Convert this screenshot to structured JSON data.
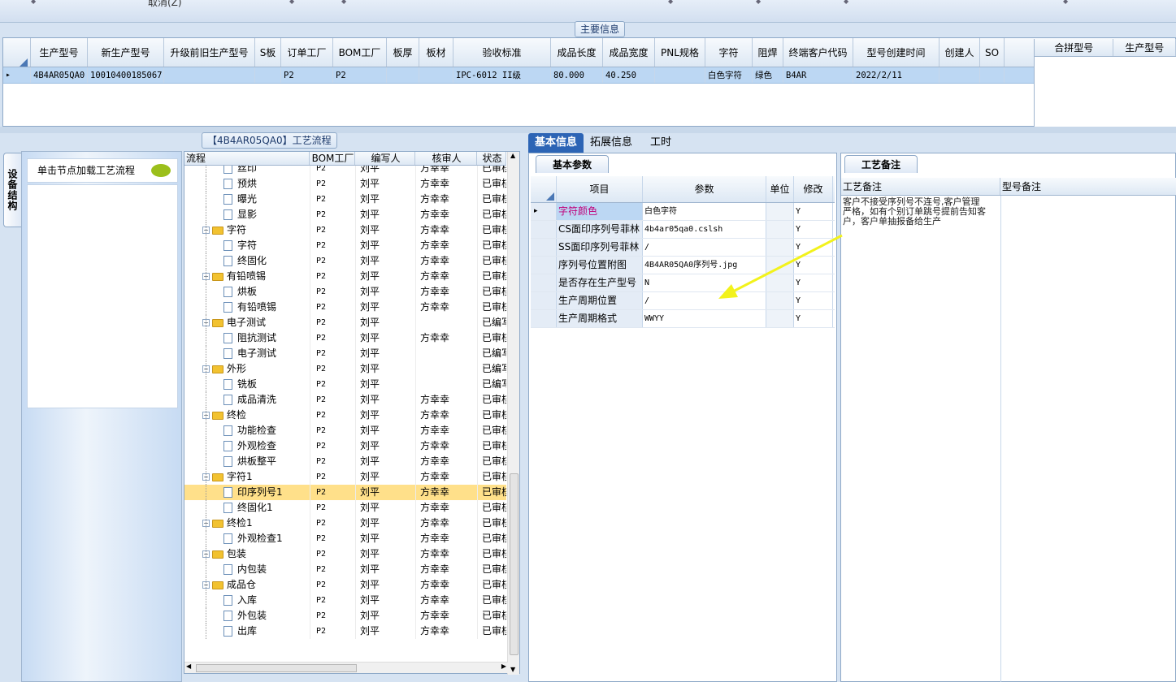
{
  "toolbar": {
    "cancel_label": "取消(Z)"
  },
  "main_info": {
    "legend": "主要信息",
    "columns": [
      "生产型号",
      "新生产型号",
      "升级前旧生产型号",
      "S板",
      "订单工厂",
      "BOM工厂",
      "板厚",
      "板材",
      "验收标准",
      "成品长度",
      "成品宽度",
      "PNL规格",
      "字符",
      "阻焊",
      "终端客户代码",
      "型号创建时间",
      "创建人",
      "SO"
    ],
    "row": {
      "生产型号": "4B4AR05QA0",
      "新生产型号": "10010400185067",
      "订单工厂": "P2",
      "BOM工厂": "P2",
      "验收标准": "IPC-6012 II级",
      "成品长度": "80.000",
      "成品宽度": "40.250",
      "字符": "白色字符",
      "阻焊": "绿色",
      "终端客户代码": "B4AR",
      "型号创建时间": "2022/2/11"
    }
  },
  "merge_panel": {
    "columns": [
      "合拼型号",
      "生产型号"
    ]
  },
  "left_panel": {
    "side_tab": "设备结构",
    "hint": "单击节点加载工艺流程"
  },
  "process_tree": {
    "title": "【4B4AR05QA0】工艺流程",
    "columns": [
      "流程",
      "BOM工厂",
      "编写人",
      "核审人",
      "状态"
    ],
    "rows": [
      {
        "name": "丝印",
        "kind": "doc",
        "bom": "P2",
        "editor": "刘平",
        "reviewer": "方幸幸",
        "status": "已审核"
      },
      {
        "name": "预烘",
        "kind": "doc",
        "bom": "P2",
        "editor": "刘平",
        "reviewer": "方幸幸",
        "status": "已审核"
      },
      {
        "name": "曝光",
        "kind": "doc",
        "bom": "P2",
        "editor": "刘平",
        "reviewer": "方幸幸",
        "status": "已审核"
      },
      {
        "name": "显影",
        "kind": "doc",
        "bom": "P2",
        "editor": "刘平",
        "reviewer": "方幸幸",
        "status": "已审核"
      },
      {
        "name": "字符",
        "kind": "folder",
        "bom": "P2",
        "editor": "刘平",
        "reviewer": "方幸幸",
        "status": "已审核"
      },
      {
        "name": "字符",
        "kind": "doc",
        "bom": "P2",
        "editor": "刘平",
        "reviewer": "方幸幸",
        "status": "已审核"
      },
      {
        "name": "终固化",
        "kind": "doc",
        "bom": "P2",
        "editor": "刘平",
        "reviewer": "方幸幸",
        "status": "已审核"
      },
      {
        "name": "有铅喷锡",
        "kind": "folder",
        "bom": "P2",
        "editor": "刘平",
        "reviewer": "方幸幸",
        "status": "已审核"
      },
      {
        "name": "烘板",
        "kind": "doc",
        "bom": "P2",
        "editor": "刘平",
        "reviewer": "方幸幸",
        "status": "已审核"
      },
      {
        "name": "有铅喷锡",
        "kind": "doc",
        "bom": "P2",
        "editor": "刘平",
        "reviewer": "方幸幸",
        "status": "已审核"
      },
      {
        "name": "电子测试",
        "kind": "folder",
        "bom": "P2",
        "editor": "刘平",
        "reviewer": "",
        "status": "已编写"
      },
      {
        "name": "阻抗测试",
        "kind": "doc",
        "bom": "P2",
        "editor": "刘平",
        "reviewer": "方幸幸",
        "status": "已审核"
      },
      {
        "name": "电子测试",
        "kind": "doc",
        "bom": "P2",
        "editor": "刘平",
        "reviewer": "",
        "status": "已编写"
      },
      {
        "name": "外形",
        "kind": "folder",
        "bom": "P2",
        "editor": "刘平",
        "reviewer": "",
        "status": "已编写"
      },
      {
        "name": "铣板",
        "kind": "doc",
        "bom": "P2",
        "editor": "刘平",
        "reviewer": "",
        "status": "已编写"
      },
      {
        "name": "成品清洗",
        "kind": "doc",
        "bom": "P2",
        "editor": "刘平",
        "reviewer": "方幸幸",
        "status": "已审核"
      },
      {
        "name": "终检",
        "kind": "folder",
        "bom": "P2",
        "editor": "刘平",
        "reviewer": "方幸幸",
        "status": "已审核"
      },
      {
        "name": "功能检查",
        "kind": "doc",
        "bom": "P2",
        "editor": "刘平",
        "reviewer": "方幸幸",
        "status": "已审核"
      },
      {
        "name": "外观检查",
        "kind": "doc",
        "bom": "P2",
        "editor": "刘平",
        "reviewer": "方幸幸",
        "status": "已审核"
      },
      {
        "name": "烘板整平",
        "kind": "doc",
        "bom": "P2",
        "editor": "刘平",
        "reviewer": "方幸幸",
        "status": "已审核"
      },
      {
        "name": "字符1",
        "kind": "folder",
        "bom": "P2",
        "editor": "刘平",
        "reviewer": "方幸幸",
        "status": "已审核"
      },
      {
        "name": "印序列号1",
        "kind": "doc",
        "bom": "P2",
        "editor": "刘平",
        "reviewer": "方幸幸",
        "status": "已审核",
        "selected": true
      },
      {
        "name": "终固化1",
        "kind": "doc",
        "bom": "P2",
        "editor": "刘平",
        "reviewer": "方幸幸",
        "status": "已审核"
      },
      {
        "name": "终检1",
        "kind": "folder",
        "bom": "P2",
        "editor": "刘平",
        "reviewer": "方幸幸",
        "status": "已审核"
      },
      {
        "name": "外观检查1",
        "kind": "doc",
        "bom": "P2",
        "editor": "刘平",
        "reviewer": "方幸幸",
        "status": "已审核"
      },
      {
        "name": "包装",
        "kind": "folder",
        "bom": "P2",
        "editor": "刘平",
        "reviewer": "方幸幸",
        "status": "已审核"
      },
      {
        "name": "内包装",
        "kind": "doc",
        "bom": "P2",
        "editor": "刘平",
        "reviewer": "方幸幸",
        "status": "已审核"
      },
      {
        "name": "成品仓",
        "kind": "folder",
        "bom": "P2",
        "editor": "刘平",
        "reviewer": "方幸幸",
        "status": "已审核"
      },
      {
        "name": "入库",
        "kind": "doc",
        "bom": "P2",
        "editor": "刘平",
        "reviewer": "方幸幸",
        "status": "已审核"
      },
      {
        "name": "外包装",
        "kind": "doc",
        "bom": "P2",
        "editor": "刘平",
        "reviewer": "方幸幸",
        "status": "已审核"
      },
      {
        "name": "出库",
        "kind": "doc",
        "bom": "P2",
        "editor": "刘平",
        "reviewer": "方幸幸",
        "status": "已审核"
      }
    ]
  },
  "detail_tabs": [
    "基本信息",
    "拓展信息",
    "工时"
  ],
  "basic_params": {
    "subtab": "基本参数",
    "columns": [
      "项目",
      "参数",
      "单位",
      "修改"
    ],
    "rows": [
      {
        "item": "字符颜色",
        "value": "白色字符",
        "unit": "",
        "modify": "Y",
        "highlight": true
      },
      {
        "item": "CS面印序列号菲林",
        "value": "4b4ar05qa0.cslsh",
        "unit": "",
        "modify": "Y"
      },
      {
        "item": "SS面印序列号菲林",
        "value": "/",
        "unit": "",
        "modify": "Y"
      },
      {
        "item": "序列号位置附图",
        "value": "4B4AR05QA0序列号.jpg",
        "unit": "",
        "modify": "Y"
      },
      {
        "item": "是否存在生产型号",
        "value": "N",
        "unit": "",
        "modify": "Y"
      },
      {
        "item": "生产周期位置",
        "value": "/",
        "unit": "",
        "modify": "Y"
      },
      {
        "item": "生产周期格式",
        "value": "WWYY",
        "unit": "",
        "modify": "Y"
      }
    ]
  },
  "process_remark": {
    "tab": "工艺备注",
    "columns": [
      "工艺备注",
      "型号备注"
    ],
    "text": "客户不接受序列号不连号,客户管理严格，如有个别订单跳号提前告知客户，客户单抽报备给生产"
  },
  "colors": {
    "accent": "#2c64b5",
    "selected_row": "#ffe08a",
    "arrow": "#f2f21c"
  }
}
